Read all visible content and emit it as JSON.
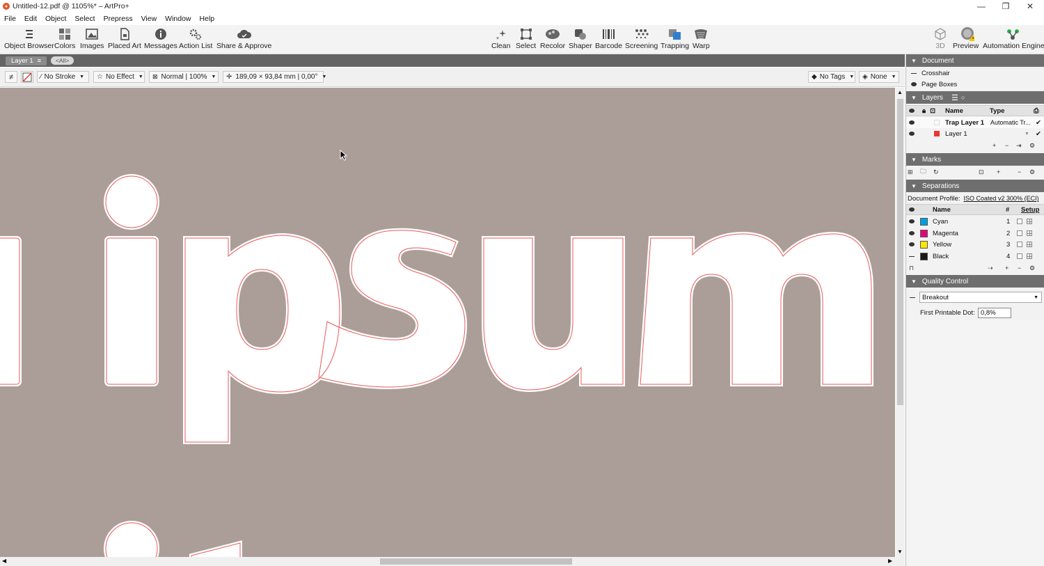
{
  "window": {
    "title": "Untitled-12.pdf @ 1105%* – ArtPro+",
    "minimize": "—",
    "maximize": "❐",
    "close": "✕"
  },
  "menu": [
    "File",
    "Edit",
    "Object",
    "Select",
    "Prepress",
    "View",
    "Window",
    "Help"
  ],
  "toolbar_left": [
    {
      "label": "Object Browser",
      "icon": "object-browser-icon"
    },
    {
      "label": "Colors",
      "icon": "colors-icon"
    },
    {
      "label": "Images",
      "icon": "images-icon"
    },
    {
      "label": "Placed Art",
      "icon": "placed-art-icon"
    },
    {
      "label": "Messages",
      "icon": "messages-icon"
    },
    {
      "label": "Action List",
      "icon": "action-list-icon"
    },
    {
      "label": "Share & Approve",
      "icon": "cloud-icon"
    }
  ],
  "toolbar_center": [
    {
      "label": "Clean",
      "icon": "clean-icon"
    },
    {
      "label": "Select",
      "icon": "select-icon"
    },
    {
      "label": "Recolor",
      "icon": "recolor-icon"
    },
    {
      "label": "Shaper",
      "icon": "shaper-icon"
    },
    {
      "label": "Barcode",
      "icon": "barcode-icon"
    },
    {
      "label": "Screening",
      "icon": "screening-icon"
    },
    {
      "label": "Trapping",
      "icon": "trapping-icon"
    },
    {
      "label": "Warp",
      "icon": "warp-icon"
    }
  ],
  "toolbar_right": [
    {
      "label": "3D",
      "icon": "3d-icon"
    },
    {
      "label": "Preview",
      "icon": "preview-icon"
    },
    {
      "label": "Automation Engine",
      "icon": "automation-engine-icon"
    }
  ],
  "layer_tabs": {
    "current": "Layer 1",
    "all": "<All>"
  },
  "options": {
    "stroke": "No Stroke",
    "effect": "No Effect",
    "blend": "Normal | 100%",
    "size": "189,09 × 93,84 mm | 0,00°",
    "tags": "No Tags",
    "none": "None"
  },
  "canvas_text": "ipsum",
  "panel": {
    "document": {
      "title": "Document",
      "items": [
        "Crosshair",
        "Page Boxes"
      ]
    },
    "layers": {
      "title": "Layers",
      "columns": [
        "Name",
        "Type"
      ],
      "rows": [
        {
          "name": "Trap Layer 1",
          "type": "Automatic Tr..."
        },
        {
          "name": "Layer 1",
          "type": ""
        }
      ]
    },
    "marks": {
      "title": "Marks"
    },
    "separations": {
      "title": "Separations",
      "profile_label": "Document Profile:",
      "profile_value": "ISO Coated v2 300% (ECI)",
      "columns": [
        "Name",
        "#",
        "Setup"
      ],
      "rows": [
        {
          "name": "Cyan",
          "num": "1",
          "color": "#00a0e0"
        },
        {
          "name": "Magenta",
          "num": "2",
          "color": "#e4007c"
        },
        {
          "name": "Yellow",
          "num": "3",
          "color": "#ffe600"
        },
        {
          "name": "Black",
          "num": "4",
          "color": "#1a1a1a"
        }
      ]
    },
    "quality": {
      "title": "Quality Control",
      "select": "Breakout",
      "dot_label": "First Printable Dot:",
      "dot_value": "0,8%"
    }
  }
}
